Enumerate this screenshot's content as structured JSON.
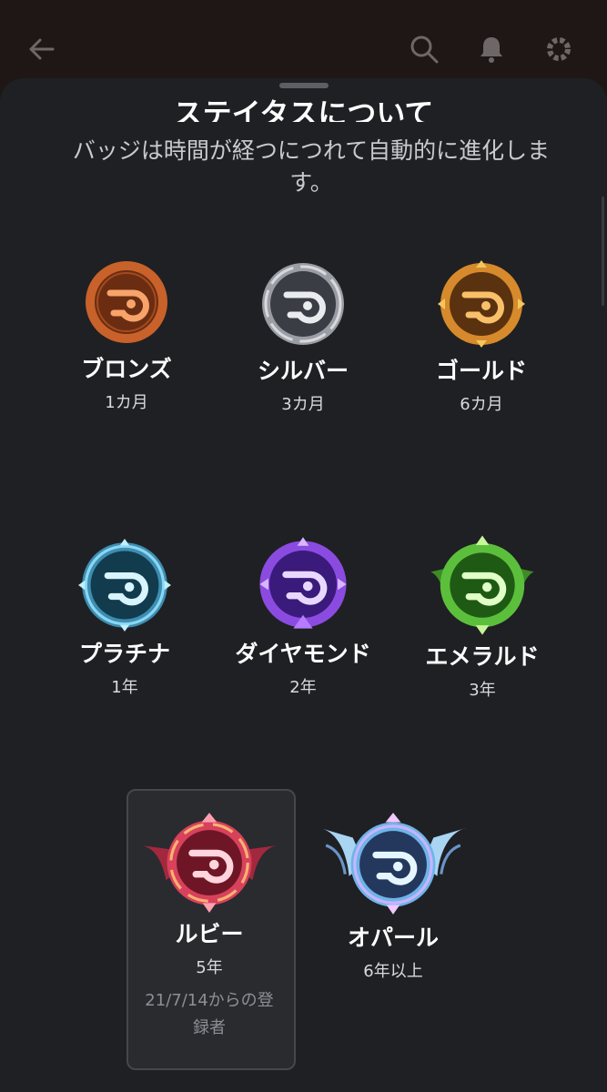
{
  "topbar": {
    "back_icon": "arrow-left-icon",
    "search_icon": "search-icon",
    "bell_icon": "bell-icon",
    "settings_icon": "gear-icon"
  },
  "sheet": {
    "title": "ステイタスについて",
    "subtitle": "バッジは時間が経つにつれて自動的に進化します。"
  },
  "badges": [
    {
      "name": "ブロンズ",
      "duration": "1カ月",
      "color": "#c8622a"
    },
    {
      "name": "シルバー",
      "duration": "3カ月",
      "color": "#9a9da3"
    },
    {
      "name": "ゴールド",
      "duration": "6カ月",
      "color": "#d68a2c"
    },
    {
      "name": "プラチナ",
      "duration": "1年",
      "color": "#4fa3c9"
    },
    {
      "name": "ダイヤモンド",
      "duration": "2年",
      "color": "#8b4be0"
    },
    {
      "name": "エメラルド",
      "duration": "3年",
      "color": "#5cbf3c"
    },
    {
      "name": "ルビー",
      "duration": "5年",
      "note": "21/7/14からの登録者",
      "color": "#d8415c"
    },
    {
      "name": "オパール",
      "duration": "6年以上",
      "color": "#6fb4e8"
    }
  ]
}
